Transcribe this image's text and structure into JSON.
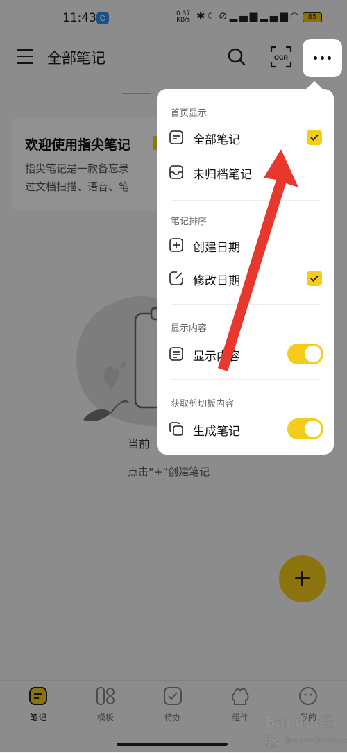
{
  "statusbar": {
    "time": "11:43",
    "speed_value": "0.37",
    "speed_unit": "KB/s",
    "battery": "85"
  },
  "topbar": {
    "title": "全部笔记",
    "ocr_label": "OCR"
  },
  "welcome": {
    "title": "欢迎使用指尖笔记",
    "line1": "指尖笔记是一款备忘录",
    "line2": "过文档扫描、语音、笔"
  },
  "empty": {
    "text": "当前",
    "hint": "点击“+”创建笔记"
  },
  "menu": {
    "section_home": "首页显示",
    "all_notes": "全部笔记",
    "unarchived": "未归档笔记",
    "section_sort": "笔记排序",
    "created_date": "创建日期",
    "modified_date": "修改日期",
    "section_content": "显示内容",
    "show_content": "显示内容",
    "section_clipboard": "获取剪切板内容",
    "generate_note": "生成笔记",
    "all_notes_checked": true,
    "modified_date_checked": true,
    "show_content_on": true,
    "generate_note_on": true
  },
  "tabs": [
    {
      "label": "笔记",
      "icon": "note-icon",
      "active": true
    },
    {
      "label": "模板",
      "icon": "template-icon",
      "active": false
    },
    {
      "label": "待办",
      "icon": "todo-icon",
      "active": false
    },
    {
      "label": "组件",
      "icon": "widget-icon",
      "active": false
    },
    {
      "label": "我的",
      "icon": "profile-icon",
      "active": false
    }
  ],
  "watermark": {
    "brand": "Bai du 经验",
    "url": "jingyan.baidu.com"
  },
  "colors": {
    "accent": "#f4cc1a",
    "annotation_arrow": "#e8372c"
  }
}
